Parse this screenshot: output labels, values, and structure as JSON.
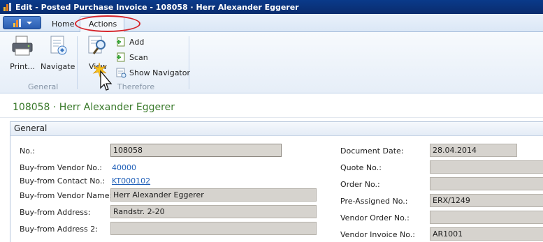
{
  "window": {
    "title": "Edit - Posted Purchase Invoice - 108058 · Herr Alexander Eggerer"
  },
  "tabs": {
    "home": "Home",
    "actions": "Actions"
  },
  "ribbon": {
    "general": {
      "label": "General",
      "print": "Print...",
      "navigate": "Navigate"
    },
    "therefore": {
      "label": "Therefore",
      "view": "View",
      "add": "Add",
      "scan": "Scan",
      "show_navigator": "Show Navigator"
    }
  },
  "page": {
    "header": "108058 · Herr Alexander Eggerer"
  },
  "fasttab": {
    "title": "General"
  },
  "fields_left": [
    {
      "label": "No.:",
      "value": "108058"
    },
    {
      "label": "Buy-from Vendor No.:",
      "value": "40000"
    },
    {
      "label": "Buy-from Contact No.:",
      "value": "KT000102"
    },
    {
      "label": "Buy-from Vendor Name:",
      "value": "Herr Alexander Eggerer"
    },
    {
      "label": "Buy-from Address:",
      "value": "Randstr. 2-20"
    },
    {
      "label": "Buy-from Address 2:",
      "value": ""
    }
  ],
  "fields_right": [
    {
      "label": "Document Date:",
      "value": "28.04.2014"
    },
    {
      "label": "Quote No.:",
      "value": ""
    },
    {
      "label": "Order No.:",
      "value": ""
    },
    {
      "label": "Pre-Assigned No.:",
      "value": "ERX/1249"
    },
    {
      "label": "Vendor Order No.:",
      "value": ""
    },
    {
      "label": "Vendor Invoice No.:",
      "value": "AR1001"
    }
  ]
}
